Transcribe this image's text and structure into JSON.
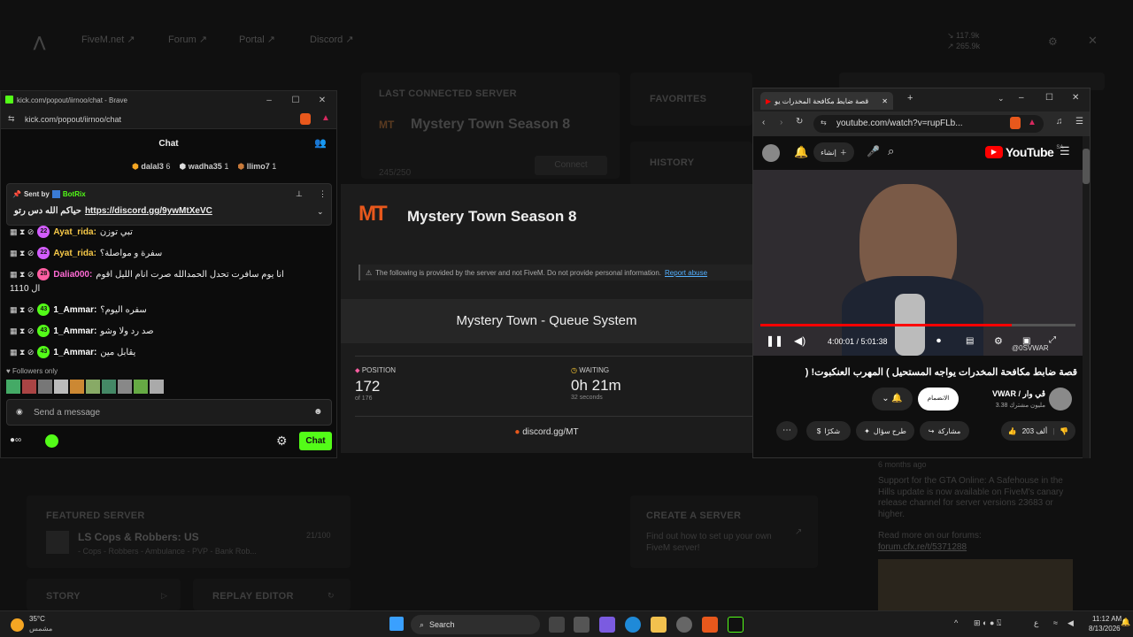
{
  "bg": {
    "nav": [
      "FiveM.net ↗",
      "Forum ↗",
      "Portal ↗",
      "Discord ↗"
    ],
    "stats": [
      "↘ 117.9k",
      "↗ 265.9k"
    ],
    "last_connected_title": "LAST CONNECTED SERVER",
    "last_server_name": "Mystery Town Season 8",
    "last_server_players": "245/250",
    "connect_label": "Connect",
    "favorites_title": "FAVORITES",
    "history_title": "HISTORY",
    "featured_title": "FEATURED SERVER",
    "featured_name": "LS Cops & Robbers: US",
    "featured_tags": "- Cops - Robbers - Ambulance - PVP - Bank Rob...",
    "featured_players": "21/100",
    "story_label": "STORY",
    "replay_label": "REPLAY EDITOR",
    "create_title": "CREATE A SERVER",
    "create_desc": "Find out how to set up your own FiveM server!",
    "news_time": "6 months ago",
    "news_text": "Support for the GTA Online: A Safehouse in the Hills update is now available on FiveM's canary release channel for server versions 23683 or higher.",
    "news_read": "Read more on our forums:",
    "news_link": "forum.cfx.re/t/5371288"
  },
  "kick": {
    "window_title": "kick.com/popout/iirnoo/chat - Brave",
    "address": "kick.com/popout/iirnoo/chat",
    "chat_title": "Chat",
    "top_gifters": [
      {
        "name": "dalal3",
        "count": "6"
      },
      {
        "name": "wadha35",
        "count": "1"
      },
      {
        "name": "llimo7",
        "count": "1"
      }
    ],
    "pinned_sent_by": "Sent by",
    "pinned_bot": "BotRix",
    "pinned_text": "حياكم الله دس رتو",
    "pinned_link": "https://discord.gg/9ywMtXeVC",
    "messages": [
      {
        "badge": "22",
        "user": "Ayat_rida:",
        "text": "تبي توزن",
        "color": "#f7c948"
      },
      {
        "badge": "22",
        "user": "Ayat_rida:",
        "text": "سفرة و مواصلة؟",
        "color": "#f7c948"
      },
      {
        "badge": "28",
        "user": "Dalia000:",
        "text": "انا يوم سافرت تحدل الحمدالله صرت انام الليل اقوم",
        "color": "#ff6bd5",
        "extra": "11ال 10"
      },
      {
        "badge": "43",
        "user": "1_Ammar:",
        "text": "سفره اليوم؟",
        "color": "#ffffff"
      },
      {
        "badge": "43",
        "user": "1_Ammar:",
        "text": "صد رد ولا وشو",
        "color": "#ffffff"
      },
      {
        "badge": "43",
        "user": "1_Ammar:",
        "text": "يقابل مين",
        "color": "#ffffff"
      }
    ],
    "followers_only": "Followers only",
    "send_placeholder": "Send a message",
    "chat_button": "Chat"
  },
  "fivem_modal": {
    "logo": "MT",
    "server_name": "Mystery Town Season 8",
    "notice": "The following is provided by the server and not FiveM. Do not provide personal information.",
    "report": "Report abuse",
    "queue_title": "Mystery Town - Queue System",
    "position_label": "POSITION",
    "position_value": "172",
    "position_of": "of 176",
    "waiting_label": "WAITING",
    "waiting_value": "0h 21m",
    "waiting_seconds": "32 seconds",
    "discord": "discord.gg/MT"
  },
  "youtube": {
    "tab_title": "قصة ضابط مكافحة المخدرات يو",
    "url": "youtube.com/watch?v=rupFLb...",
    "create_label": "إنشاء",
    "logo_text": "YouTube",
    "logo_region": "SA",
    "time": "4:00:01 / 5:01:38",
    "watermark": "@0SVWAR",
    "video_title": "قصة ضابط مكافحة المخدرات يواجه المستحيل ) المهرب العنكبوت! (",
    "channel": "VWAR / ڤي وار",
    "subs": "3.38 مليون مشترك",
    "join_label": "الانضمام",
    "likes": "203 ألف",
    "share": "مشاركة",
    "ask": "طرح سؤال",
    "thanks": "شكرًا",
    "progress": 0.797
  },
  "taskbar": {
    "temp": "35°C",
    "weather": "مشمس",
    "search": "Search",
    "time": "11:12 AM",
    "date": "8/13/2026"
  }
}
